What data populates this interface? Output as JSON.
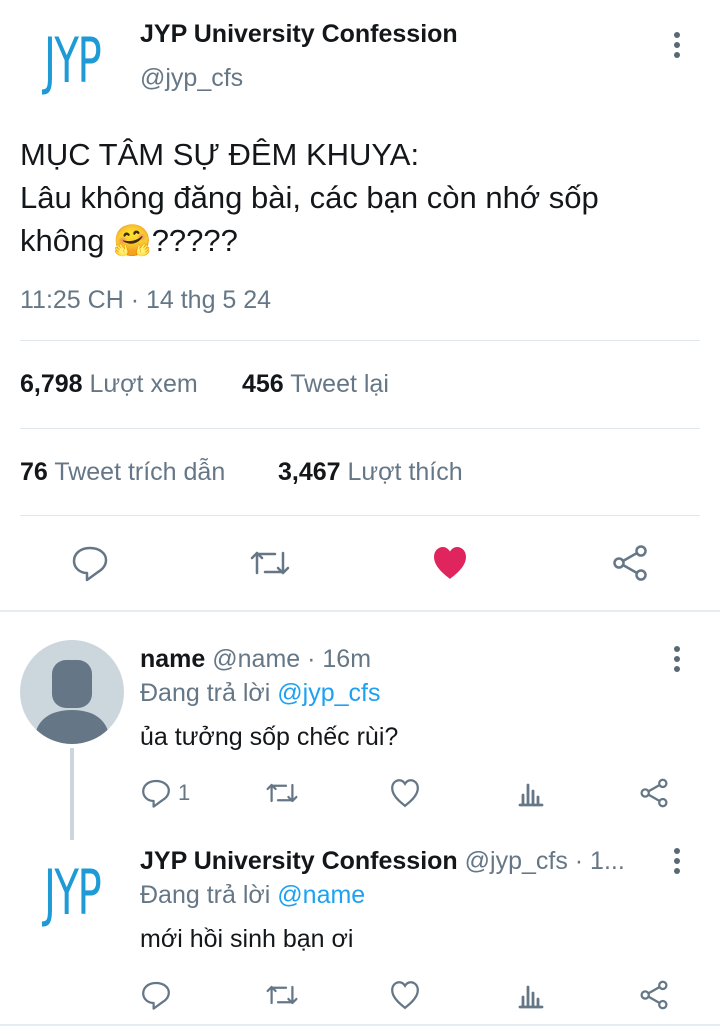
{
  "main_tweet": {
    "logo_text": "JYP",
    "display_name": "JYP University Confession",
    "handle": "@jyp_cfs",
    "text_line1": "MỤC TÂM SỰ ĐÊM KHUYA:",
    "text_line2": "Lâu không đăng bài, các bạn còn nhớ sốp",
    "text_line3_a": "không ",
    "text_line3_b": "?????",
    "emoji": "🤗",
    "timestamp": "11:25 CH · 14 thg 5 24",
    "stats": {
      "views_count": "6,798",
      "views_label": "Lượt xem",
      "retweets_count": "456",
      "retweets_label": "Tweet lại",
      "quotes_count": "76",
      "quotes_label": "Tweet trích dẫn",
      "likes_count": "3,467",
      "likes_label": "Lượt thích"
    },
    "liked": true,
    "like_color": "#e0245e",
    "accent_color": "#1da1f2"
  },
  "reply1": {
    "display_name": "name",
    "meta": "@name · 16m",
    "replying_prefix": "Đang trả lời ",
    "replying_to": "@jyp_cfs",
    "text": "ủa tưởng sốp chếc rùi?",
    "reply_count": "1"
  },
  "reply2": {
    "logo_text": "JYP",
    "display_name": "JYP University Confession",
    "meta": "@jyp_cfs · 1...",
    "replying_prefix": "Đang trả lời ",
    "replying_to": "@name",
    "text": "mới hồi sinh bạn ơi"
  },
  "icons": {
    "more": "more-vertical-icon",
    "reply": "reply-bubble-icon",
    "retweet": "retweet-icon",
    "like": "heart-icon",
    "share": "share-icon",
    "analytics": "analytics-bars-icon",
    "avatar": "default-avatar-icon"
  }
}
